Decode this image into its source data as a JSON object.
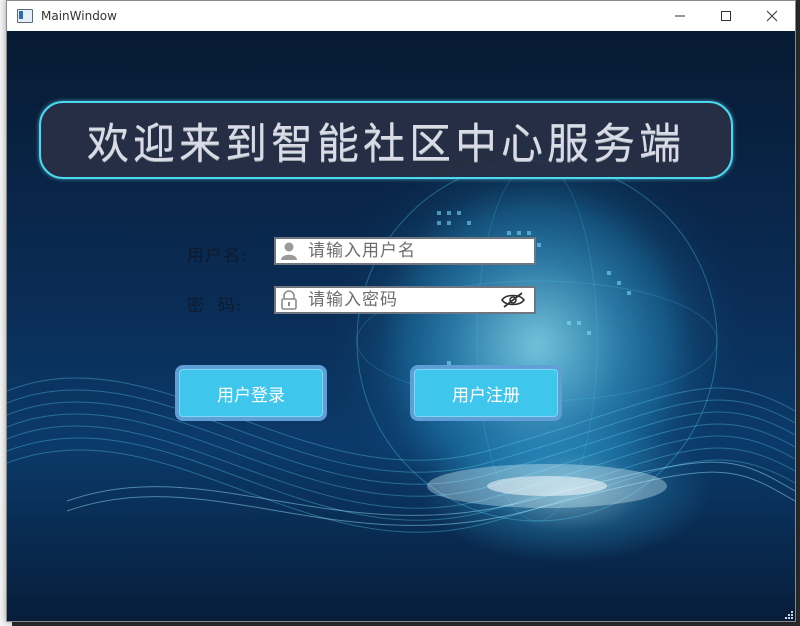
{
  "window": {
    "title": "MainWindow",
    "controls": {
      "minimize_icon": "minimize-icon",
      "maximize_icon": "maximize-icon",
      "close_icon": "close-icon"
    }
  },
  "banner": {
    "title": "欢迎来到智能社区中心服务端"
  },
  "form": {
    "username_label": "用户名:",
    "username_placeholder": "请输入用户名",
    "username_value": "",
    "password_label": "密  码:",
    "password_placeholder": "请输入密码",
    "password_value": ""
  },
  "buttons": {
    "login_label": "用户登录",
    "register_label": "用户注册"
  },
  "colors": {
    "accent": "#3fc6ec",
    "banner_border": "#4ad9f0",
    "banner_bg": "#283044"
  }
}
